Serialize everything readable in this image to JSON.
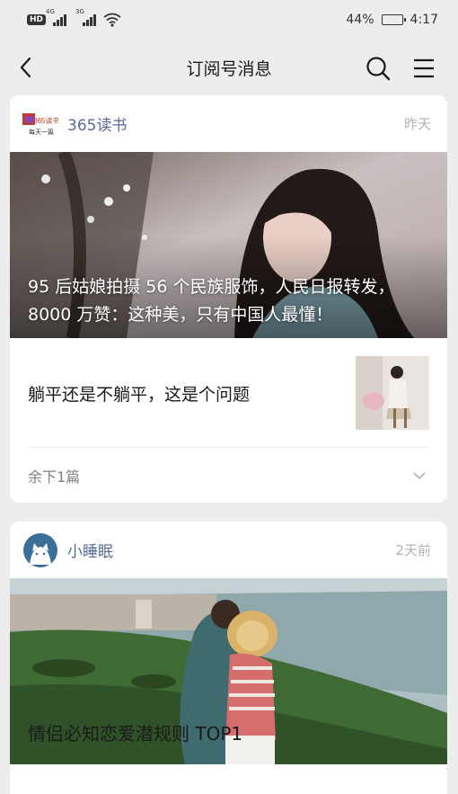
{
  "status_bar": {
    "network_badge": "HD",
    "signal_1": "4G",
    "signal_2": "3G",
    "battery_percent": "44%",
    "battery_level": 0.44,
    "time": "4:17"
  },
  "nav": {
    "title": "订阅号消息"
  },
  "cards": [
    {
      "account_name": "365读书",
      "logo_text": "365读书",
      "logo_sub": "每天一篇",
      "time": "昨天",
      "headline": "95 后姑娘拍摄 56 个民族服饰，人民日报转发，8000 万赞：这种美，只有中国人最懂！",
      "sub_article": "躺平还是不躺平，这是个问题",
      "more": "余下1篇"
    },
    {
      "account_name": "小睡眠",
      "time": "2天前",
      "headline": "情侣必知恋爱潜规则 TOP1"
    }
  ],
  "colors": {
    "page_bg": "#ededed",
    "account_name": "#576b95",
    "time_gray": "#b2b2b2"
  }
}
